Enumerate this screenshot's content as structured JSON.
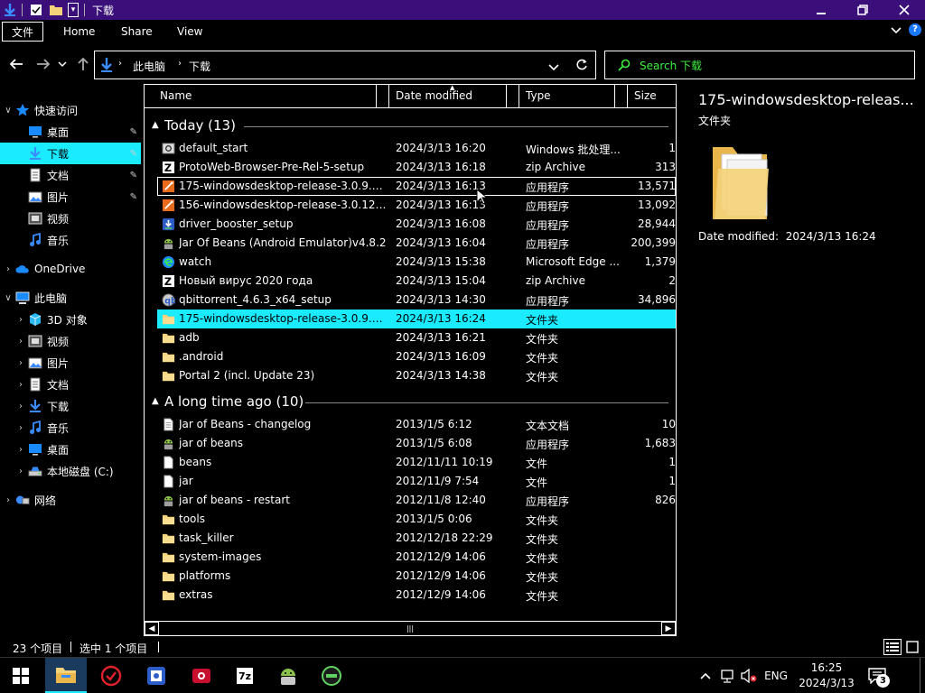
{
  "window": {
    "title": "下载",
    "controls": {
      "minimize": "—",
      "maximize": "□",
      "close": "✕"
    }
  },
  "ribbon": {
    "tabs": [
      "文件",
      "Home",
      "Share",
      "View"
    ]
  },
  "address": {
    "crumbs": [
      "此电脑",
      "下载"
    ]
  },
  "search": {
    "placeholder": "Search 下载"
  },
  "sidebar": {
    "quick_access": "快速访问",
    "quick_items": [
      {
        "label": "桌面",
        "icon": "desktop-icon",
        "pinned": true
      },
      {
        "label": "下载",
        "icon": "download-icon",
        "pinned": true,
        "active": true
      },
      {
        "label": "文档",
        "icon": "documents-icon",
        "pinned": true
      },
      {
        "label": "图片",
        "icon": "pictures-icon",
        "pinned": true
      },
      {
        "label": "视频",
        "icon": "video-icon",
        "pinned": false
      },
      {
        "label": "音乐",
        "icon": "music-icon",
        "pinned": false
      }
    ],
    "onedrive": "OneDrive",
    "this_pc": "此电脑",
    "pc_items": [
      {
        "label": "3D 对象",
        "icon": "3d-objects-icon"
      },
      {
        "label": "视频",
        "icon": "video-icon"
      },
      {
        "label": "图片",
        "icon": "pictures-icon"
      },
      {
        "label": "文档",
        "icon": "documents-icon"
      },
      {
        "label": "下载",
        "icon": "download-icon"
      },
      {
        "label": "音乐",
        "icon": "music-icon"
      },
      {
        "label": "桌面",
        "icon": "desktop-icon"
      },
      {
        "label": "本地磁盘 (C:)",
        "icon": "drive-icon"
      }
    ],
    "network": "网络"
  },
  "columns": {
    "name": "Name",
    "date": "Date modified",
    "type": "Type",
    "size": "Size"
  },
  "groups": [
    {
      "title": "Today (13)",
      "items": [
        {
          "name": "default_start",
          "date": "2024/3/13 16:20",
          "type": "Windows 批处理...",
          "size": "1",
          "icon": "batch-file-icon"
        },
        {
          "name": "ProtoWeb-Browser-Pre-Rel-5-setup",
          "date": "2024/3/13 16:18",
          "type": "zip Archive",
          "size": "313",
          "icon": "zip-icon"
        },
        {
          "name": "175-windowsdesktop-release-3.0.9.0...",
          "date": "2024/3/13 16:13",
          "type": "应用程序",
          "size": "13,571",
          "icon": "installer-icon",
          "hover": true
        },
        {
          "name": "156-windowsdesktop-release-3.0.12....",
          "date": "2024/3/13 16:13",
          "type": "应用程序",
          "size": "13,092",
          "icon": "installer-icon"
        },
        {
          "name": "driver_booster_setup",
          "date": "2024/3/13 16:08",
          "type": "应用程序",
          "size": "28,944",
          "icon": "driver-booster-icon"
        },
        {
          "name": "Jar Of Beans (Android Emulator)v4.8.2",
          "date": "2024/3/13 16:04",
          "type": "应用程序",
          "size": "200,399",
          "icon": "android-icon"
        },
        {
          "name": "watch",
          "date": "2024/3/13 15:38",
          "type": "Microsoft Edge ...",
          "size": "1,379",
          "icon": "edge-icon"
        },
        {
          "name": "Новый вирус 2020 года",
          "date": "2024/3/13 15:04",
          "type": "zip Archive",
          "size": "2",
          "icon": "zip-icon"
        },
        {
          "name": "qbittorrent_4.6.3_x64_setup",
          "date": "2024/3/13 14:30",
          "type": "应用程序",
          "size": "34,896",
          "icon": "qbittorrent-icon"
        },
        {
          "name": "175-windowsdesktop-release-3.0.9.0...",
          "date": "2024/3/13 16:24",
          "type": "文件夹",
          "size": "",
          "icon": "folder-icon",
          "selected": true
        },
        {
          "name": "adb",
          "date": "2024/3/13 16:21",
          "type": "文件夹",
          "size": "",
          "icon": "folder-icon"
        },
        {
          "name": ".android",
          "date": "2024/3/13 16:09",
          "type": "文件夹",
          "size": "",
          "icon": "folder-icon"
        },
        {
          "name": "Portal 2 (incl. Update 23)",
          "date": "2024/3/13 14:38",
          "type": "文件夹",
          "size": "",
          "icon": "folder-icon"
        }
      ]
    },
    {
      "title": "A long time ago (10)",
      "items": [
        {
          "name": "Jar of Beans - changelog",
          "date": "2013/1/5 6:12",
          "type": "文本文档",
          "size": "10",
          "icon": "text-file-icon"
        },
        {
          "name": "jar of beans",
          "date": "2013/1/5 6:08",
          "type": "应用程序",
          "size": "1,683",
          "icon": "android-icon"
        },
        {
          "name": "beans",
          "date": "2012/11/11 10:19",
          "type": "文件",
          "size": "1",
          "icon": "file-icon"
        },
        {
          "name": "jar",
          "date": "2012/11/9 7:54",
          "type": "文件",
          "size": "1",
          "icon": "file-icon"
        },
        {
          "name": "jar of beans - restart",
          "date": "2012/11/8 12:40",
          "type": "应用程序",
          "size": "826",
          "icon": "android-icon"
        },
        {
          "name": "tools",
          "date": "2013/1/5 0:06",
          "type": "文件夹",
          "size": "",
          "icon": "folder-icon"
        },
        {
          "name": "task_killer",
          "date": "2012/12/18 22:29",
          "type": "文件夹",
          "size": "",
          "icon": "folder-icon"
        },
        {
          "name": "system-images",
          "date": "2012/12/9 14:06",
          "type": "文件夹",
          "size": "",
          "icon": "folder-icon"
        },
        {
          "name": "platforms",
          "date": "2012/12/9 14:06",
          "type": "文件夹",
          "size": "",
          "icon": "folder-icon"
        },
        {
          "name": "extras",
          "date": "2012/12/9 14:06",
          "type": "文件夹",
          "size": "",
          "icon": "folder-icon"
        }
      ]
    }
  ],
  "preview": {
    "title": "175-windowsdesktop-releas...",
    "type": "文件夹",
    "date_label": "Date modified:",
    "date_value": "2024/3/13 16:24"
  },
  "status": {
    "count": "23 个项目",
    "selected": "选中 1 个项目"
  },
  "taskbar": {
    "tray_lang": "ENG",
    "clock_time": "16:25",
    "clock_date": "2024/3/13",
    "notification_count": "3"
  },
  "colors": {
    "title_bar": "#3a0f7a",
    "selection": "#1aebff",
    "search_text": "#3ef03e",
    "folder": "#f3d27a"
  }
}
